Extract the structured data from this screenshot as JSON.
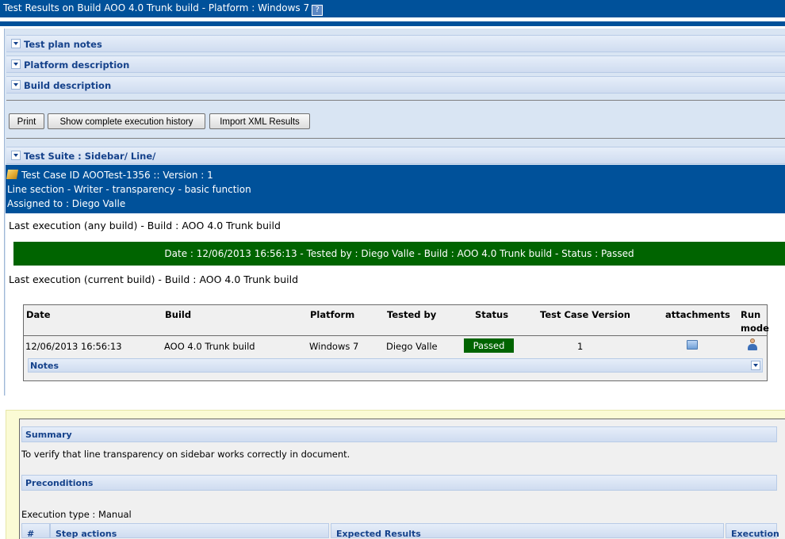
{
  "header": {
    "title": "Test Results on Build AOO 4.0 Trunk build - Platform : Windows 7",
    "help_icon_glyph": "?"
  },
  "sections": {
    "test_plan_notes": "Test plan notes",
    "platform_description": "Platform description",
    "build_description": "Build description"
  },
  "toolbar": {
    "print_label": "Print",
    "history_label": "Show complete execution history",
    "import_label": "Import XML Results"
  },
  "suite": {
    "label": "Test Suite : Sidebar/ Line/"
  },
  "test_case": {
    "id_line": "Test Case ID AOOTest-1356 :: Version : 1",
    "name": "Line section - Writer - transparency - basic function",
    "assigned": "Assigned to : Diego Valle"
  },
  "last_exec_any": {
    "label": "Last execution (any build) - Build : AOO 4.0 Trunk build",
    "status_line": "Date : 12/06/2013 16:56:13 - Tested by : Diego Valle - Build : AOO 4.0 Trunk build - Status : Passed"
  },
  "last_exec_current": {
    "label": "Last execution (current build) - Build : AOO 4.0 Trunk build"
  },
  "exec_table": {
    "headers": {
      "date": "Date",
      "build": "Build",
      "platform": "Platform",
      "tested_by": "Tested by",
      "status": "Status",
      "tc_version": "Test Case Version",
      "attachments": "attachments",
      "run_mode_1": "Run",
      "run_mode_2": "mode"
    },
    "row": {
      "date": "12/06/2013 16:56:13",
      "build": "AOO 4.0 Trunk build",
      "platform": "Windows 7",
      "tested_by": "Diego Valle",
      "status": "Passed",
      "tc_version": "1"
    },
    "notes_label": "Notes"
  },
  "spec": {
    "summary_label": "Summary",
    "summary_text": "To verify that line transparency on sidebar works correctly in document.",
    "preconditions_label": "Preconditions",
    "execution_type": "Execution type : Manual",
    "steps_headers": {
      "num": "#",
      "actions": "Step actions",
      "expected": "Expected Results",
      "execution": "Execution"
    }
  },
  "colors": {
    "header_blue": "#00519a",
    "passed_green": "#006400",
    "panel_blue": "#d9e5f3",
    "spec_yellow": "#fbfbd5"
  }
}
